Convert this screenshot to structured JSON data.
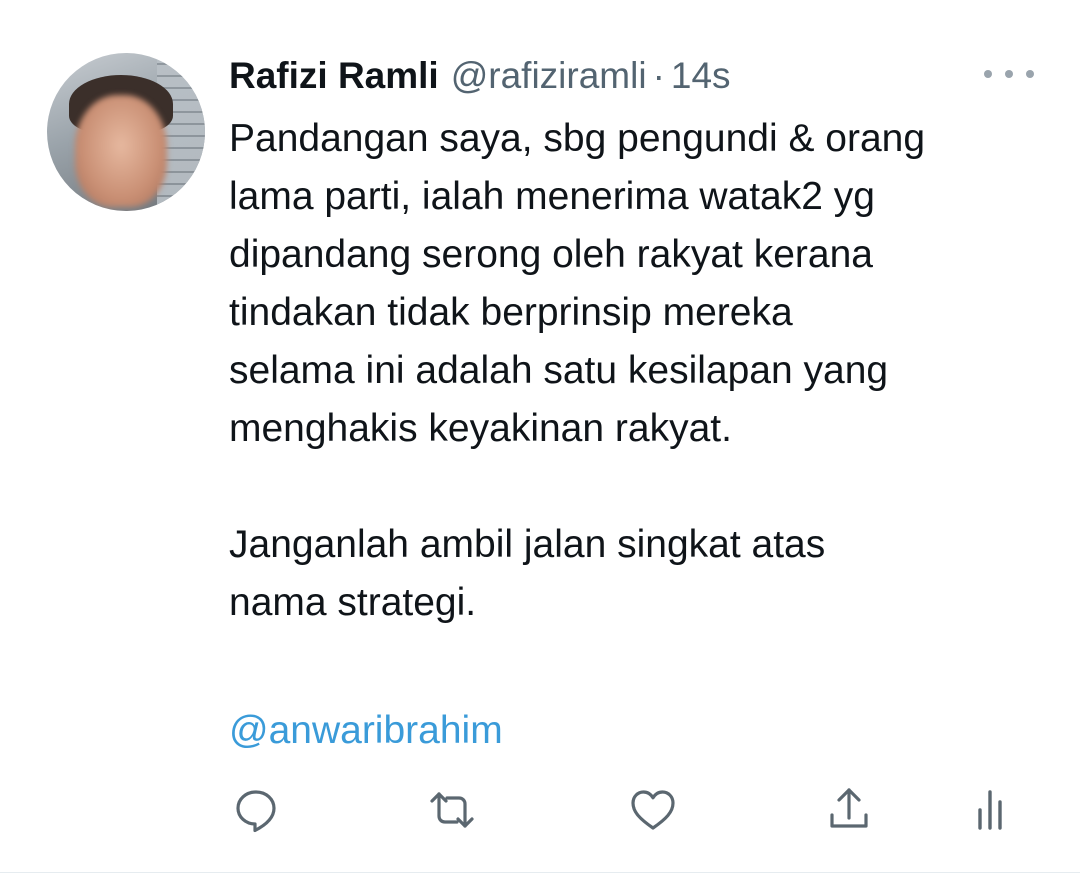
{
  "tweet": {
    "author_name": "Rafizi Ramli",
    "author_handle": "@rafiziramli",
    "separator": "·",
    "timestamp": "14s",
    "more_icon": "more-horizontal-icon",
    "body_lines_para1": [
      "Pandangan saya, sbg pengundi & orang",
      "lama parti, ialah menerima watak2 yg",
      "dipandang serong oleh rakyat kerana",
      "tindakan tidak berprinsip mereka",
      "selama ini adalah satu kesilapan yang",
      "menghakis keyakinan rakyat."
    ],
    "body_lines_para2": [
      "Janganlah ambil jalan singkat atas",
      "nama strategi."
    ],
    "mention": "@anwaribrahim"
  },
  "actions": {
    "icons": [
      "reply-icon",
      "retweet-icon",
      "like-icon",
      "share-icon",
      "analytics-icon"
    ]
  },
  "colors": {
    "text": "#0f1419",
    "secondary": "#536471",
    "link": "#3a9bd9",
    "icon": "#5b6770"
  }
}
